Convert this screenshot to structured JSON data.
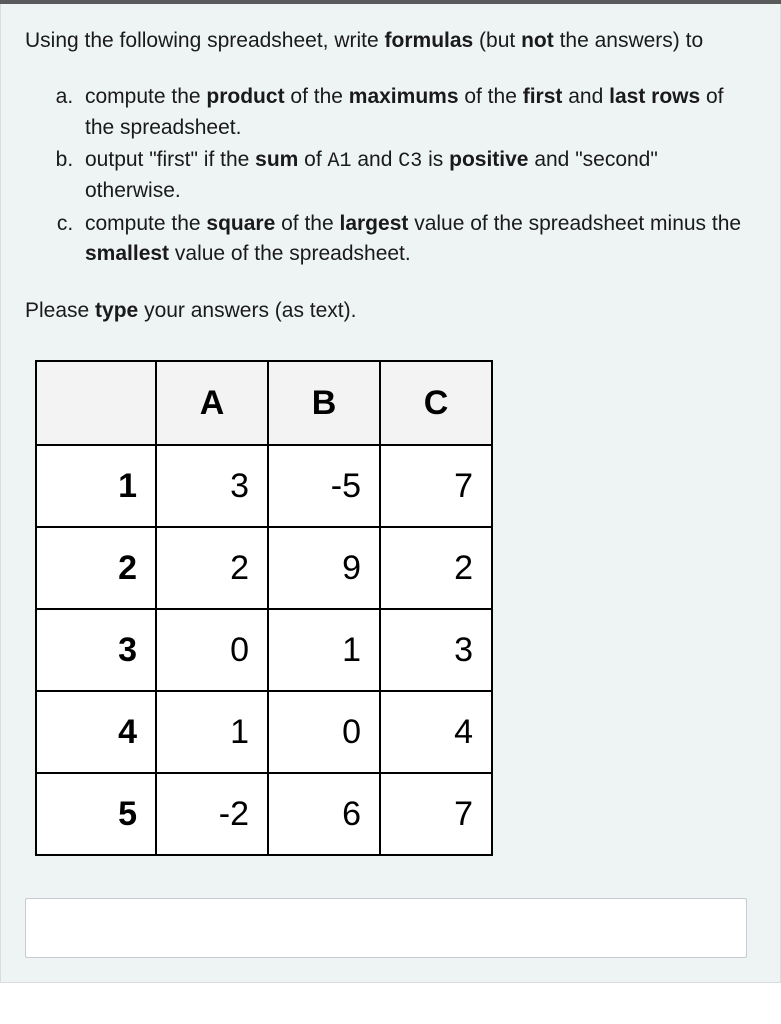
{
  "intro": {
    "pre": "Using the following spreadsheet, write ",
    "b1": "formulas",
    "mid": " (but ",
    "b2": "not",
    "post": " the answers) to"
  },
  "questions": {
    "a": {
      "t1": "compute the ",
      "b1": "product",
      "t2": " of the ",
      "b2": "maximums",
      "t3": " of the ",
      "b3": "first",
      "t4": " and ",
      "b4": "last rows",
      "t5": " of the spreadsheet."
    },
    "b": {
      "t1": "output \"first\" if the ",
      "b1": "sum",
      "t2": " of ",
      "c1": "A1",
      "t3": " and ",
      "c2": "C3",
      "t4": " is ",
      "b2": "positive",
      "t5": " and \"second\" otherwise."
    },
    "c": {
      "t1": "compute the ",
      "b1": "square",
      "t2": " of the ",
      "b2": "largest",
      "t3": " value of the spreadsheet minus the ",
      "b3": "smallest",
      "t4": " value of the spreadsheet."
    }
  },
  "type_line": {
    "t1": "Please ",
    "b1": "type",
    "t2": " your answers (as text)."
  },
  "table": {
    "headers": {
      "blank": "",
      "A": "A",
      "B": "B",
      "C": "C"
    },
    "row_labels": [
      "1",
      "2",
      "3",
      "4",
      "5"
    ],
    "rows": [
      {
        "A": "3",
        "B": "-5",
        "C": "7"
      },
      {
        "A": "2",
        "B": "9",
        "C": "2"
      },
      {
        "A": "0",
        "B": "1",
        "C": "3"
      },
      {
        "A": "1",
        "B": "0",
        "C": "4"
      },
      {
        "A": "-2",
        "B": "6",
        "C": "7"
      }
    ]
  },
  "answer_value": ""
}
